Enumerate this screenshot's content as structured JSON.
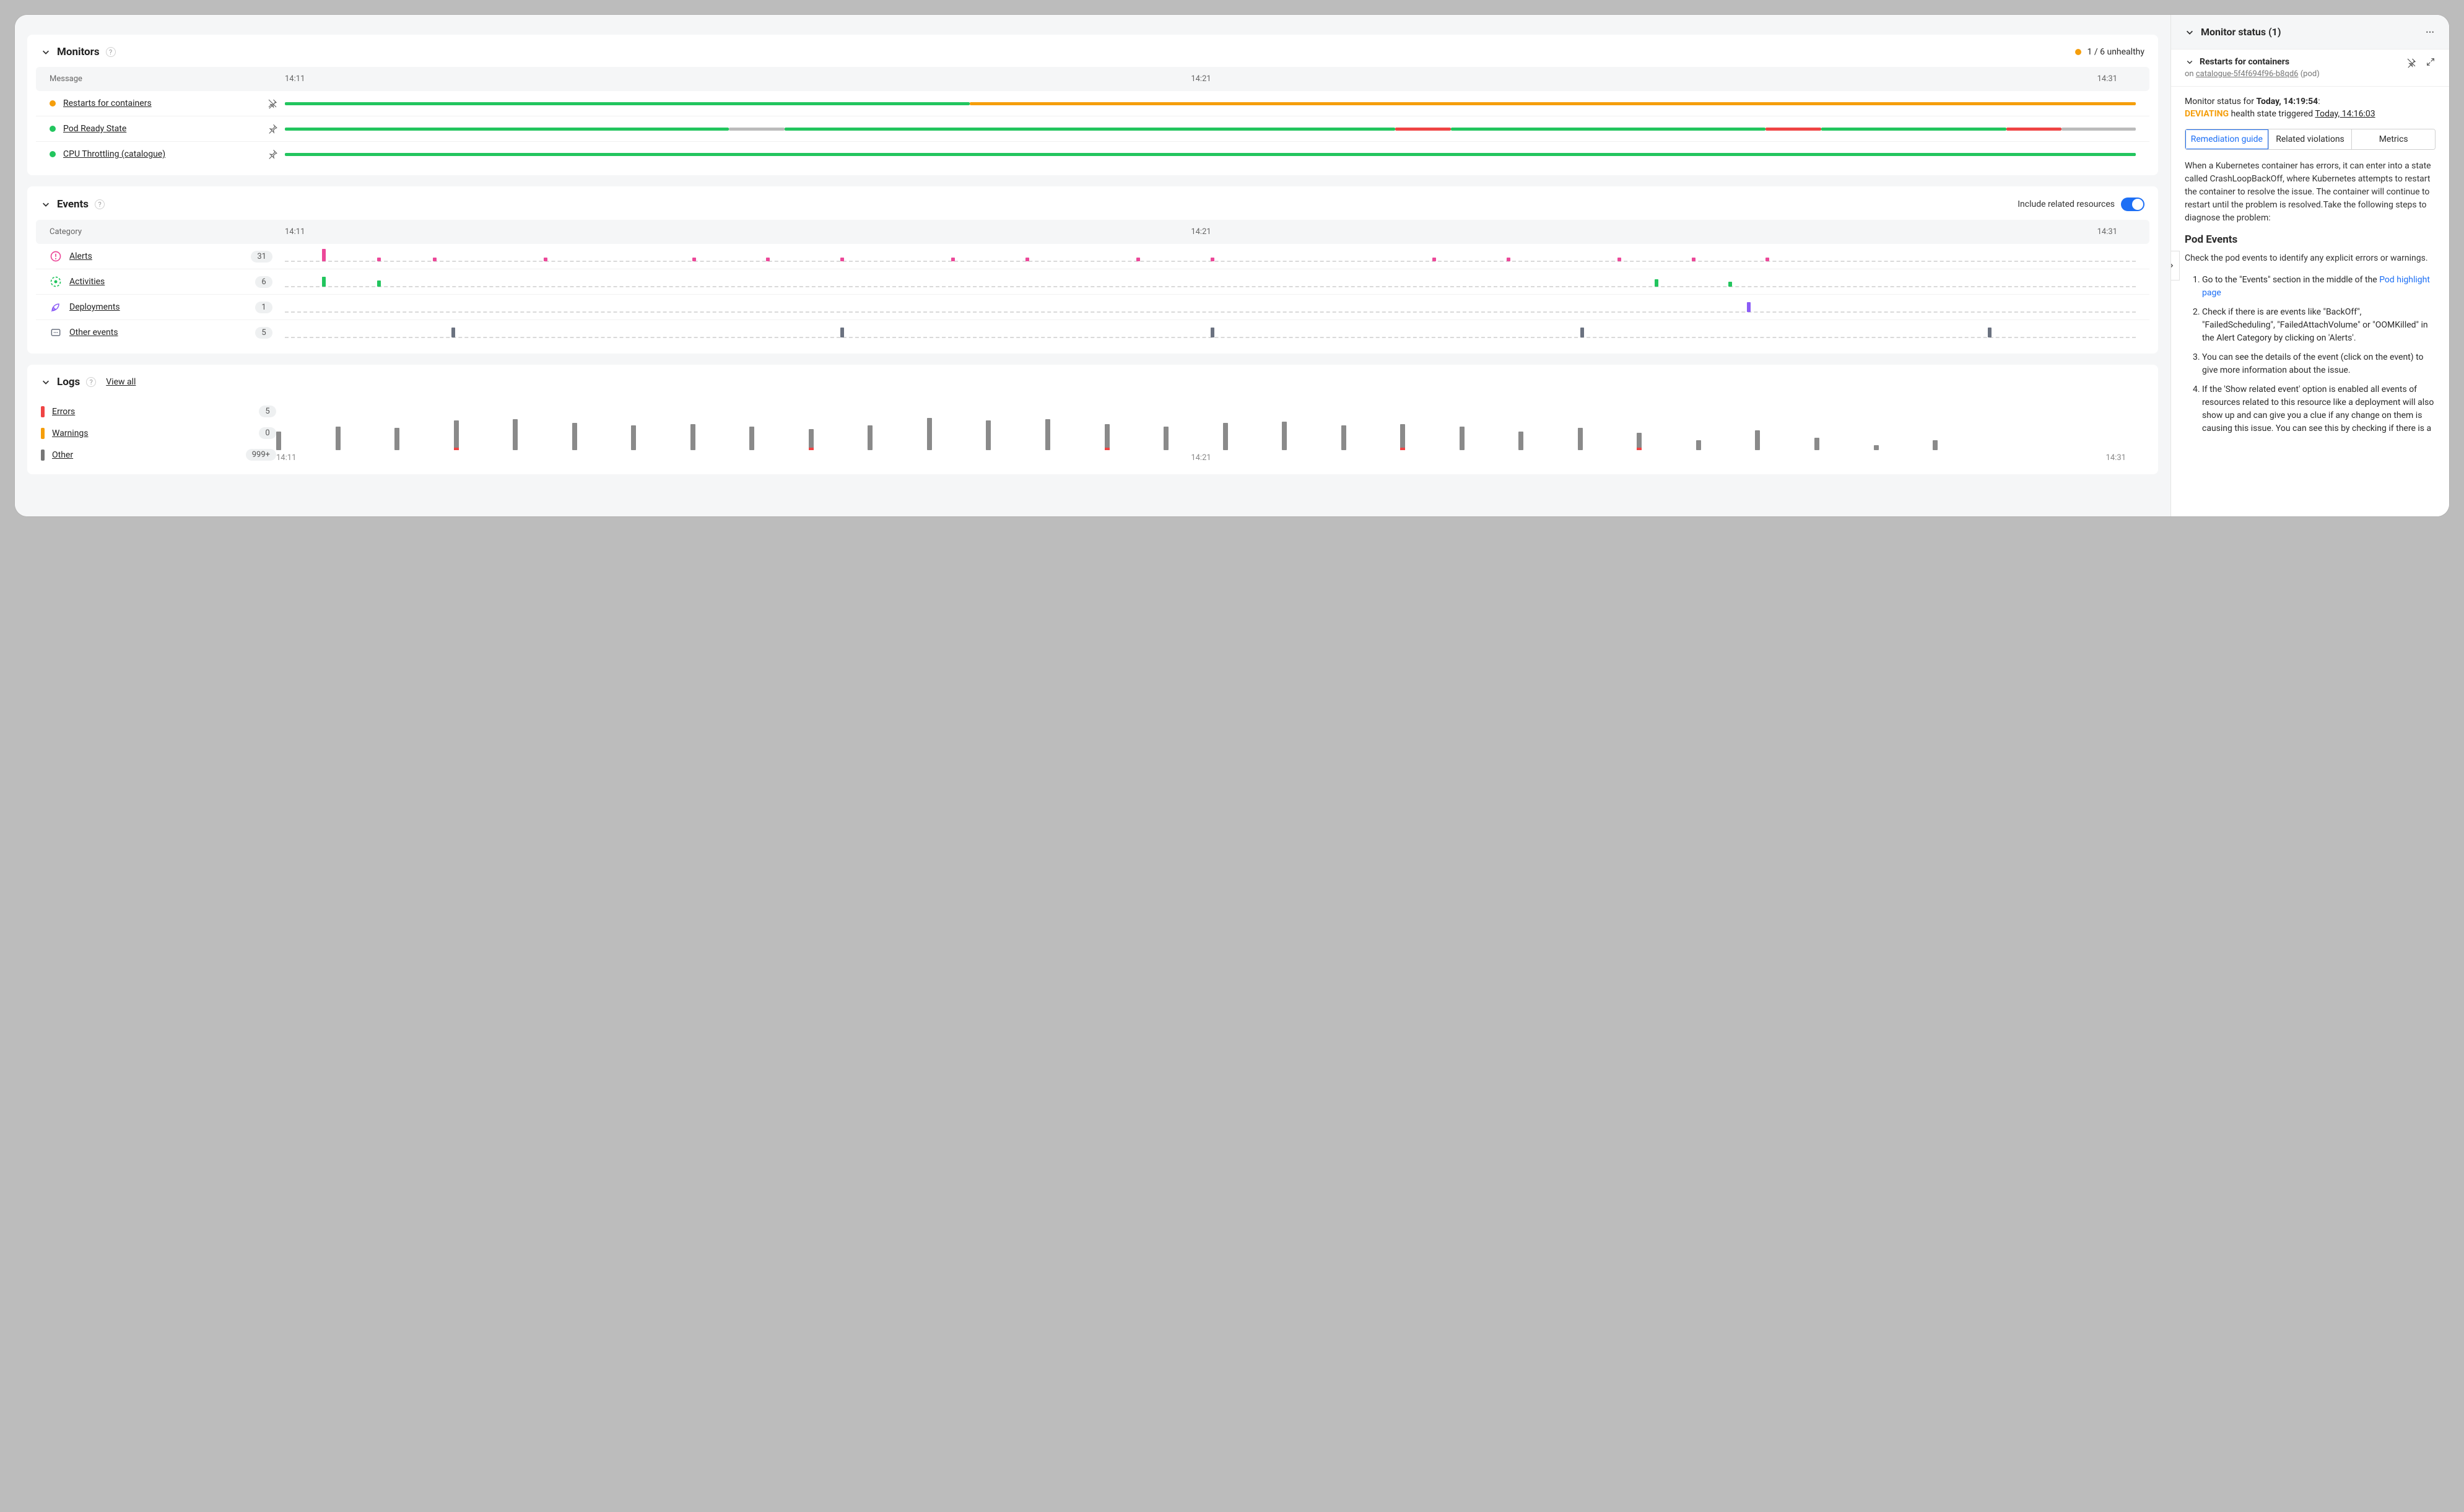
{
  "monitors": {
    "title": "Monitors",
    "unhealthy": "1 / 6 unhealthy",
    "col_message": "Message",
    "times": [
      "14:11",
      "14:21",
      "14:31"
    ],
    "rows": [
      {
        "label": "Restarts for containers",
        "color": "orange",
        "pinned": true
      },
      {
        "label": "Pod Ready State",
        "color": "green",
        "pinned": false
      },
      {
        "label": "CPU Throttling (catalogue)",
        "color": "green",
        "pinned": false
      }
    ]
  },
  "events": {
    "title": "Events",
    "include_label": "Include related resources",
    "col_category": "Category",
    "times": [
      "14:11",
      "14:21",
      "14:31"
    ],
    "rows": [
      {
        "label": "Alerts",
        "count": "31",
        "icon": "alert",
        "color": "#ec4899"
      },
      {
        "label": "Activities",
        "count": "6",
        "icon": "activity",
        "color": "#22c55e"
      },
      {
        "label": "Deployments",
        "count": "1",
        "icon": "deploy",
        "color": "#8b5cf6"
      },
      {
        "label": "Other events",
        "count": "5",
        "icon": "other",
        "color": "#6b7280"
      }
    ]
  },
  "logs": {
    "title": "Logs",
    "view_all": "View all",
    "times": [
      "14:11",
      "14:21",
      "14:31"
    ],
    "cats": [
      {
        "label": "Errors",
        "count": "5",
        "sw": "log-red"
      },
      {
        "label": "Warnings",
        "count": "0",
        "sw": "log-org"
      },
      {
        "label": "Other",
        "count": "999+",
        "sw": "log-gray"
      }
    ]
  },
  "chart_data": {
    "monitors_timeline": {
      "type": "timeline",
      "time_axis": [
        "14:11",
        "14:21",
        "14:31"
      ],
      "series": [
        {
          "name": "Restarts for containers",
          "segments": [
            {
              "from": 0,
              "to": 0.37,
              "state": "green"
            },
            {
              "from": 0.37,
              "to": 1.0,
              "state": "orange"
            }
          ]
        },
        {
          "name": "Pod Ready State",
          "segments": [
            {
              "from": 0,
              "to": 0.24,
              "state": "green"
            },
            {
              "from": 0.24,
              "to": 0.27,
              "state": "gray"
            },
            {
              "from": 0.27,
              "to": 0.6,
              "state": "green"
            },
            {
              "from": 0.6,
              "to": 0.63,
              "state": "red"
            },
            {
              "from": 0.63,
              "to": 0.8,
              "state": "green"
            },
            {
              "from": 0.8,
              "to": 0.83,
              "state": "red"
            },
            {
              "from": 0.83,
              "to": 0.93,
              "state": "green"
            },
            {
              "from": 0.93,
              "to": 0.96,
              "state": "red"
            },
            {
              "from": 0.96,
              "to": 1.0,
              "state": "gray"
            }
          ]
        },
        {
          "name": "CPU Throttling (catalogue)",
          "segments": [
            {
              "from": 0,
              "to": 1.0,
              "state": "green"
            }
          ]
        }
      ]
    },
    "events_histogram": {
      "type": "bar",
      "time_axis": [
        "14:11",
        "14:21",
        "14:31"
      ],
      "note": "x-positions are fractions of timeline width; heights in px as rendered",
      "series": [
        {
          "name": "Alerts",
          "color": "#ec4899",
          "bars": [
            {
              "x": 0.02,
              "h": 20
            },
            {
              "x": 0.05,
              "h": 6
            },
            {
              "x": 0.08,
              "h": 6
            },
            {
              "x": 0.14,
              "h": 6
            },
            {
              "x": 0.22,
              "h": 6
            },
            {
              "x": 0.26,
              "h": 6
            },
            {
              "x": 0.3,
              "h": 6
            },
            {
              "x": 0.36,
              "h": 6
            },
            {
              "x": 0.4,
              "h": 6
            },
            {
              "x": 0.46,
              "h": 6
            },
            {
              "x": 0.5,
              "h": 6
            },
            {
              "x": 0.62,
              "h": 6
            },
            {
              "x": 0.66,
              "h": 6
            },
            {
              "x": 0.72,
              "h": 6
            },
            {
              "x": 0.76,
              "h": 6
            },
            {
              "x": 0.8,
              "h": 6
            }
          ]
        },
        {
          "name": "Activities",
          "color": "#22c55e",
          "bars": [
            {
              "x": 0.02,
              "h": 16
            },
            {
              "x": 0.05,
              "h": 10
            },
            {
              "x": 0.74,
              "h": 12
            },
            {
              "x": 0.78,
              "h": 8
            }
          ]
        },
        {
          "name": "Deployments",
          "color": "#8b5cf6",
          "bars": [
            {
              "x": 0.79,
              "h": 16
            }
          ]
        },
        {
          "name": "Other events",
          "color": "#6b7280",
          "bars": [
            {
              "x": 0.09,
              "h": 16
            },
            {
              "x": 0.3,
              "h": 16
            },
            {
              "x": 0.5,
              "h": 16
            },
            {
              "x": 0.7,
              "h": 16
            },
            {
              "x": 0.92,
              "h": 16
            }
          ]
        }
      ]
    },
    "logs_histogram": {
      "type": "bar",
      "time_axis": [
        "14:11",
        "14:21",
        "14:31"
      ],
      "bars_other": [
        30,
        38,
        36,
        48,
        50,
        44,
        40,
        42,
        38,
        34,
        40,
        52,
        48,
        50,
        42,
        38,
        44,
        46,
        40,
        42,
        38,
        30,
        36,
        28,
        16,
        32,
        20,
        8,
        16,
        0
      ],
      "bars_error_idx": [
        3,
        9,
        14,
        19,
        23
      ]
    }
  },
  "side": {
    "header": "Monitor status (1)",
    "card_title": "Restarts for containers",
    "on": "on",
    "resource": "catalogue-5f4f694f96-b8qd6",
    "resource_type": "(pod)",
    "status_prefix": "Monitor status for ",
    "status_time": "Today, 14:19:54",
    "dev": "DEVIATING",
    "dev_suffix": " health state triggered ",
    "dev_time": "Today, 14:16:03",
    "tabs": [
      "Remediation guide",
      "Related violations",
      "Metrics"
    ],
    "p1": "When a Kubernetes container has errors, it can enter into a state called CrashLoopBackOff, where Kubernetes attempts to restart the container to resolve the issue. The container will continue to restart until the problem is resolved.Take the following steps to diagnose the problem:",
    "h1": "Pod Events",
    "p2": "Check the pod events to identify any explicit errors or warnings.",
    "li1a": "Go to the \"Events\" section in the middle of the ",
    "li1b": "Pod highlight page",
    "li2": "Check if there is are events like \"BackOff\", \"FailedScheduling\", \"FailedAttachVolume\" or \"OOMKilled\" in the Alert Category by clicking on 'Alerts'.",
    "li3": "You can see the details of the event (click on the event) to give more information about the issue.",
    "li4": "If the 'Show related event' option is enabled all events of resources related to this resource like a deployment will also show up and can give you a clue if any change on them is causing this issue. You can see this by checking if there is a"
  }
}
